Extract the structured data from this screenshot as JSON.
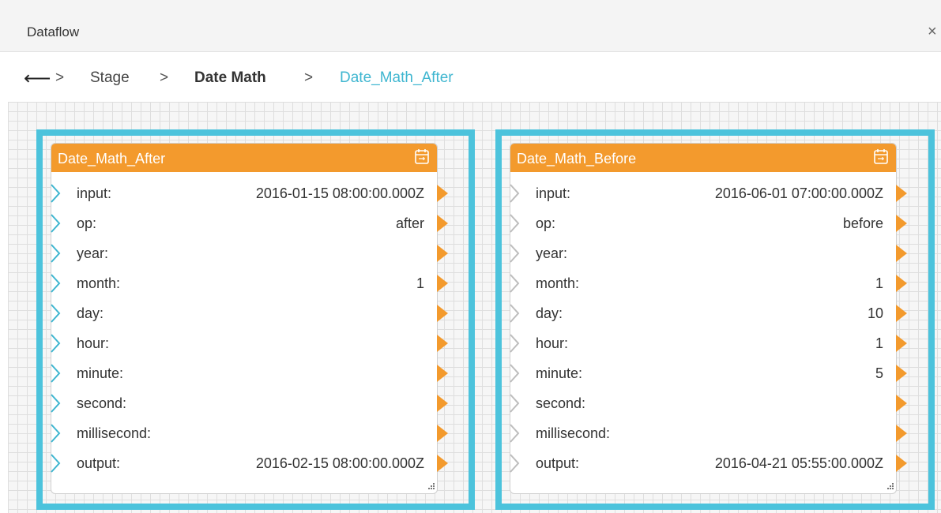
{
  "window": {
    "title": "Dataflow",
    "close_glyph": "×"
  },
  "breadcrumb": {
    "back_glyph": "⟵",
    "sep1": ">",
    "sep2": ">",
    "sep3": ">",
    "items": [
      "Stage",
      "Date Math",
      "Date_Math_After"
    ]
  },
  "colors": {
    "accent": "#4cc3dc",
    "header": "#f39a2d",
    "port_out": "#f39a2d",
    "port_in_selected": "#3fb6d0",
    "port_in": "#bdbdbd"
  },
  "nodes": [
    {
      "title": "Date_Math_After",
      "icon": "calendar-icon",
      "selected": true,
      "rows": [
        {
          "label": "input:",
          "value": "2016-01-15 08:00:00.000Z"
        },
        {
          "label": "op:",
          "value": "after"
        },
        {
          "label": "year:",
          "value": ""
        },
        {
          "label": "month:",
          "value": "1"
        },
        {
          "label": "day:",
          "value": ""
        },
        {
          "label": "hour:",
          "value": ""
        },
        {
          "label": "minute:",
          "value": ""
        },
        {
          "label": "second:",
          "value": ""
        },
        {
          "label": "millisecond:",
          "value": ""
        },
        {
          "label": "output:",
          "value": "2016-02-15 08:00:00.000Z"
        }
      ]
    },
    {
      "title": "Date_Math_Before",
      "icon": "calendar-icon",
      "selected": false,
      "rows": [
        {
          "label": "input:",
          "value": "2016-06-01 07:00:00.000Z"
        },
        {
          "label": "op:",
          "value": "before"
        },
        {
          "label": "year:",
          "value": ""
        },
        {
          "label": "month:",
          "value": "1"
        },
        {
          "label": "day:",
          "value": "10"
        },
        {
          "label": "hour:",
          "value": "1"
        },
        {
          "label": "minute:",
          "value": "5"
        },
        {
          "label": "second:",
          "value": ""
        },
        {
          "label": "millisecond:",
          "value": ""
        },
        {
          "label": "output:",
          "value": "2016-04-21 05:55:00.000Z"
        }
      ]
    }
  ]
}
